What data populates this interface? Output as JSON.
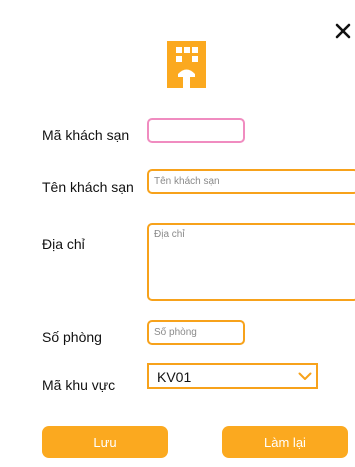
{
  "colors": {
    "accent": "#f7a21b",
    "button": "#fba91f",
    "focus_border": "#f08cc0"
  },
  "icons": {
    "close": "close-icon",
    "header": "hotel-icon",
    "dropdown": "chevron-down-icon"
  },
  "form": {
    "hotel_code": {
      "label": "Mã khách sạn",
      "value": "",
      "placeholder": ""
    },
    "hotel_name": {
      "label": "Tên khách sạn",
      "value": "",
      "placeholder": "Tên khách sạn"
    },
    "address": {
      "label": "Địa chỉ",
      "value": "",
      "placeholder": "Địa chỉ"
    },
    "room_count": {
      "label": "Số phòng",
      "value": "",
      "placeholder": "Số phòng"
    },
    "area_code": {
      "label": "Mã khu vực",
      "selected": "KV01"
    }
  },
  "buttons": {
    "save": "Lưu",
    "reset": "Làm lại"
  }
}
